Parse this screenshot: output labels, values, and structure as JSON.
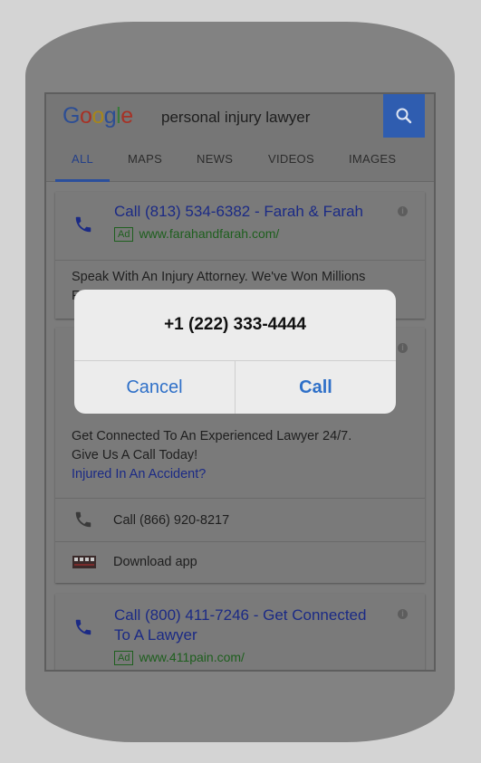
{
  "search": {
    "logo": "Google",
    "query": "personal injury lawyer",
    "logo_colors": [
      "#2d4e94",
      "#a63226",
      "#a7861a",
      "#2d4e94",
      "#3a7a3c",
      "#a63226"
    ]
  },
  "tabs": [
    {
      "label": "ALL"
    },
    {
      "label": "MAPS"
    },
    {
      "label": "NEWS"
    },
    {
      "label": "VIDEOS"
    },
    {
      "label": "IMAGES"
    }
  ],
  "ad1": {
    "title": "Call (813) 534-6382 - Farah & Farah",
    "badge": "Ad",
    "url": "www.farahandfarah.com/",
    "description": "Speak With An Injury Attorney. We've Won Millions",
    "description_cutoff": "F"
  },
  "ad2": {
    "line1": "Get Connected To An Experienced Lawyer 24/7.",
    "line2": "Give Us A Call Today!",
    "link": "Injured In An Accident?",
    "call_row": "Call (866) 920-8217",
    "download_row": "Download app"
  },
  "ad3": {
    "title_line1": "Call (800) 411-7246 - Get Connected",
    "title_line2": "To A Lawyer",
    "badge": "Ad",
    "url": "www.411pain.com/"
  },
  "dialog": {
    "number": "+1 (222) 333-4444",
    "cancel": "Cancel",
    "call": "Call"
  },
  "colors": {
    "accent_blue": "#2f70c8",
    "link_blue": "#1b2a85",
    "ad_green": "#1e5f1e"
  }
}
